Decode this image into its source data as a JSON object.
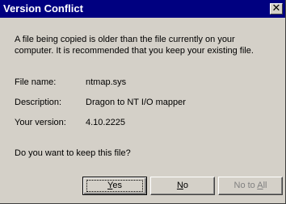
{
  "window": {
    "title": "Version Conflict",
    "close_icon": "close-icon"
  },
  "message": {
    "line1": "A file being copied is older than the file currently on your",
    "line2": "computer. It is recommended that you keep your existing file."
  },
  "details": {
    "file_name_label": "File name:",
    "file_name_value": "ntmap.sys",
    "description_label": "Description:",
    "description_value": "Dragon to NT I/O mapper",
    "version_label": "Your version:",
    "version_value": "4.10.2225"
  },
  "question": "Do you want to keep this file?",
  "buttons": {
    "yes": "Yes",
    "no": "No",
    "no_to_all": "No to All"
  },
  "colors": {
    "titlebar": "#000080",
    "dialog_bg": "#d4d0c8",
    "disabled_text": "#808080"
  }
}
